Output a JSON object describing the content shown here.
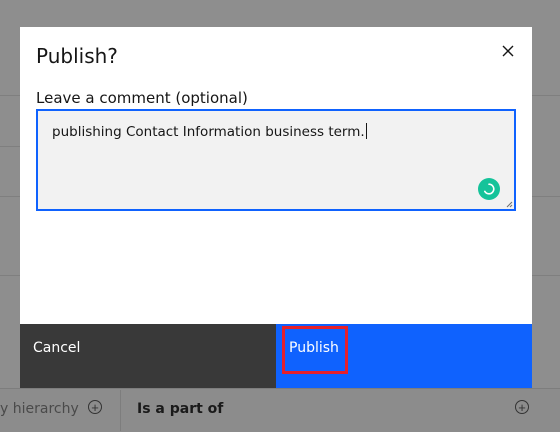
{
  "background": {
    "hierarchy_text": "y hierarchy",
    "is_part_of_label": "Is a part of",
    "add_icon_glyph": "+"
  },
  "dialog": {
    "title": "Publish?",
    "close_icon": "close-icon",
    "comment_label": "Leave a comment (optional)",
    "comment_value": "publishing Contact Information business term.",
    "cancel_label": "Cancel",
    "publish_label": "Publish",
    "colors": {
      "primary": "#0f62fe",
      "secondary": "#393939",
      "highlight": "#e5202a",
      "assistant_icon": "#15c39a"
    }
  }
}
